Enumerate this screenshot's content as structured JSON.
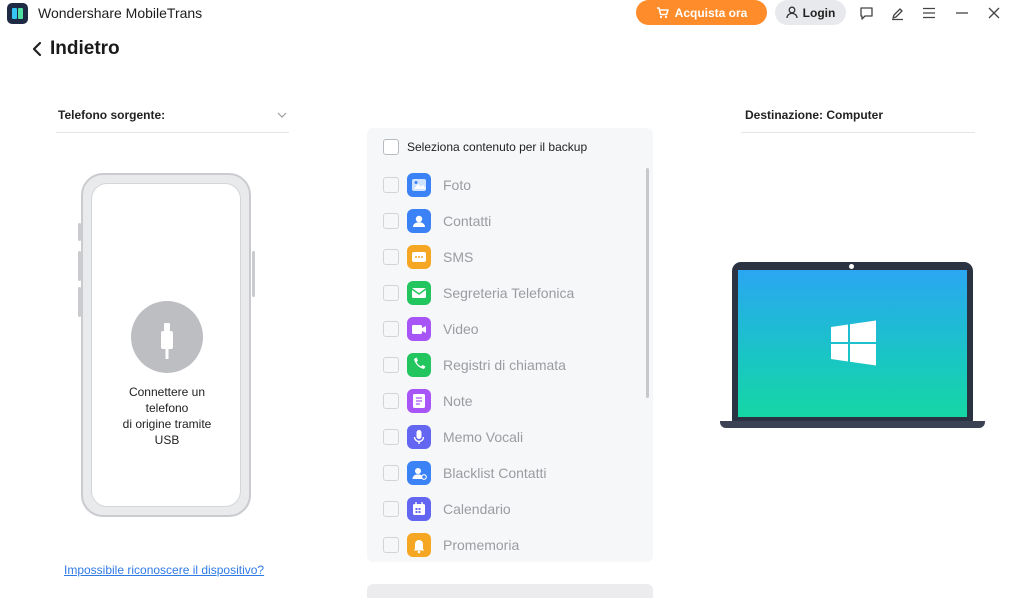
{
  "app": {
    "title": "Wondershare MobileTrans",
    "buy_label": "Acquista ora",
    "login_label": "Login",
    "accent_orange": "#ff8c2b"
  },
  "nav": {
    "back_label": "Indietro"
  },
  "source": {
    "label": "Telefono sorgente:",
    "connect_message": "Connettere un\ntelefono\n di origine tramite\nUSB",
    "help_link": "Impossibile riconoscere il dispositivo?"
  },
  "content": {
    "select_all_label": "Seleziona contenuto per il backup",
    "items": [
      {
        "label": "Foto",
        "icon": "photo-icon",
        "color": "#3b82f6"
      },
      {
        "label": "Contatti",
        "icon": "contacts-icon",
        "color": "#3b82f6"
      },
      {
        "label": "SMS",
        "icon": "sms-icon",
        "color": "#f5a623"
      },
      {
        "label": "Segreteria Telefonica",
        "icon": "voicemail-icon",
        "color": "#22c55e"
      },
      {
        "label": "Video",
        "icon": "video-icon",
        "color": "#a855f7"
      },
      {
        "label": "Registri di chiamata",
        "icon": "call-log-icon",
        "color": "#22c55e"
      },
      {
        "label": "Note",
        "icon": "notes-icon",
        "color": "#a855f7"
      },
      {
        "label": "Memo Vocali",
        "icon": "microphone-icon",
        "color": "#6366f1"
      },
      {
        "label": "Blacklist Contatti",
        "icon": "blacklist-icon",
        "color": "#3b82f6"
      },
      {
        "label": "Calendario",
        "icon": "calendar-icon",
        "color": "#6366f1"
      },
      {
        "label": "Promemoria",
        "icon": "reminder-icon",
        "color": "#f5a623"
      }
    ]
  },
  "destination": {
    "label": "Destinazione: Computer"
  }
}
